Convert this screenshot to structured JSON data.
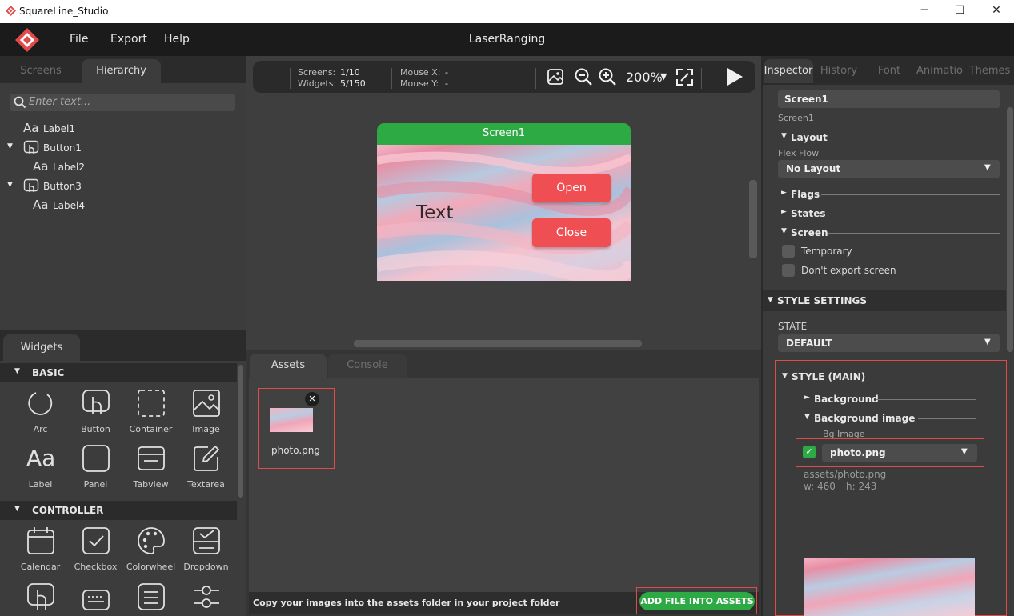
{
  "window": {
    "title": "SquareLine_Studio",
    "minimize": "─",
    "maximize": "☐",
    "close": "✕"
  },
  "menu": {
    "file": "File",
    "export": "Export",
    "help": "Help",
    "project_name": "LaserRanging"
  },
  "left_panel": {
    "tabs": [
      "Screens",
      "Hierarchy"
    ],
    "search_placeholder": "Enter text...",
    "tree": [
      {
        "glyph": "Aa",
        "label": "Label1"
      },
      {
        "glyph": "button",
        "label": "Button1",
        "expanded": true
      },
      {
        "glyph": "Aa",
        "label": "Label2"
      },
      {
        "glyph": "button",
        "label": "Button3",
        "expanded": true
      },
      {
        "glyph": "Aa",
        "label": "Label4"
      }
    ]
  },
  "widgets": {
    "tab": "Widgets",
    "sections": {
      "basic": "BASIC",
      "controller": "CONTROLLER"
    },
    "basic_items": [
      "Arc",
      "Button",
      "Container",
      "Image",
      "Label",
      "Panel",
      "Tabview",
      "Textarea"
    ],
    "controller_items": [
      "Calendar",
      "Checkbox",
      "Colorwheel",
      "Dropdown"
    ]
  },
  "toolbar": {
    "screens_label": "Screens:",
    "screens_value": "1/10",
    "widgets_label": "Widgets:",
    "widgets_value": "5/150",
    "mouse_x_label": "Mouse X:",
    "mouse_x_value": "-",
    "mouse_y_label": "Mouse Y:",
    "mouse_y_value": "-",
    "zoom": "200%"
  },
  "screen_preview": {
    "title": "Screen1",
    "text_label": "Text",
    "open_button": "Open",
    "close_button": "Close"
  },
  "assets": {
    "tabs": [
      "Assets",
      "Console"
    ],
    "file_name": "photo.png",
    "hint": "Copy your images into the assets folder in your project folder",
    "add_button": "ADD FILE INTO ASSETS"
  },
  "inspector": {
    "tabs": [
      "Inspector",
      "History",
      "Font",
      "Animatio",
      "Themes"
    ],
    "name_value": "Screen1",
    "type_label": "Screen1",
    "layout_section": "Layout",
    "flex_flow_label": "Flex Flow",
    "flex_flow_value": "No Layout",
    "flags_section": "Flags",
    "states_section": "States",
    "screen_section": "Screen",
    "temporary_label": "Temporary",
    "dont_export_label": "Don't export screen",
    "style_settings": "STYLE SETTINGS",
    "state_label": "STATE",
    "state_value": "DEFAULT",
    "style_main": "STYLE (MAIN)",
    "background_section": "Background",
    "background_image_section": "Background image",
    "bg_image_label": "Bg Image",
    "bg_image_value": "photo.png",
    "asset_path": "assets/photo.png",
    "asset_w": "w: 460",
    "asset_h": "h: 243"
  },
  "colors": {
    "accent_green": "#2eaa44",
    "button_red": "#ef4f52",
    "highlight_red": "#e24a4a"
  }
}
